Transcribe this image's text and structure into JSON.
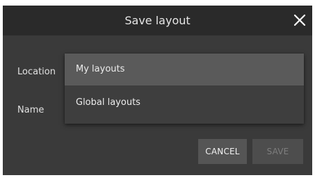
{
  "dialog": {
    "title": "Save layout",
    "close_icon": "close-icon"
  },
  "form": {
    "location_label": "Location",
    "name_label": "Name"
  },
  "location_dropdown": {
    "options": [
      {
        "label": "My layouts",
        "selected": true
      },
      {
        "label": "Global layouts",
        "selected": false
      }
    ]
  },
  "actions": {
    "cancel_label": "CANCEL",
    "save_label": "SAVE",
    "save_disabled": true
  },
  "colors": {
    "dialog_bg": "#3a3a3a",
    "titlebar_bg": "#2a2a2a",
    "menu_bg": "#3e3e3e",
    "menu_selected_bg": "#5a5a5a",
    "button_bg": "#555555"
  }
}
